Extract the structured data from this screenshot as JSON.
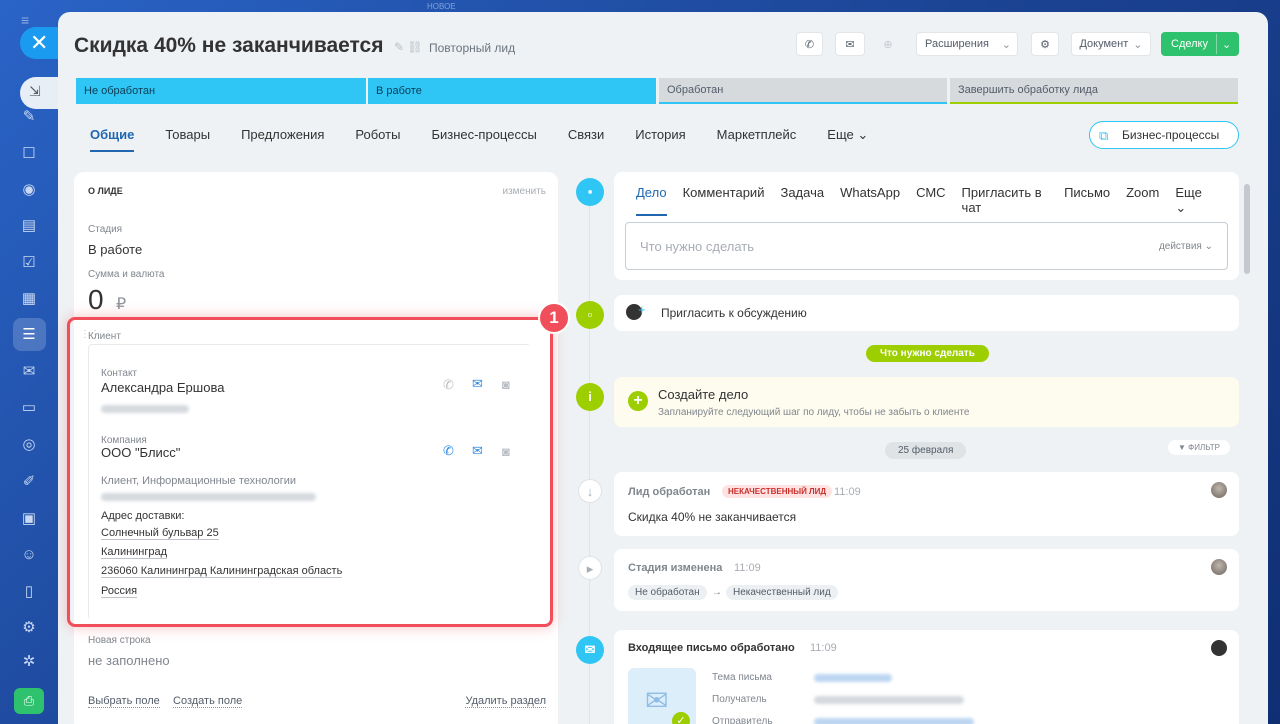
{
  "rail": {
    "top_label": "НОВОЕ"
  },
  "header": {
    "title": "Скидка 40% не заканчивается",
    "repeat_label": "Повторный лид",
    "extensions": "Расширения",
    "document": "Документ",
    "deal": "Сделку"
  },
  "stages": [
    "Не обработан",
    "В работе",
    "Обработан",
    "Завершить обработку лида"
  ],
  "tabs": [
    "Общие",
    "Товары",
    "Предложения",
    "Роботы",
    "Бизнес-процессы",
    "Связи",
    "История",
    "Маркетплейс",
    "Еще"
  ],
  "bp_button": "Бизнес-процессы",
  "about": {
    "title": "О ЛИДЕ",
    "edit": "изменить",
    "stage_label": "Стадия",
    "stage_value": "В работе",
    "sum_label": "Сумма и валюта",
    "sum_value": "0",
    "currency": "₽",
    "client_label": "Клиент",
    "contact_label": "Контакт",
    "contact_name": "Александра Ершова",
    "company_label": "Компания",
    "company_name": "ООО \"Блисс\"",
    "company_type": "Клиент, Информационные технологии",
    "address_label": "Адрес доставки:",
    "address_lines": [
      "Солнечный бульвар 25",
      "Калининград",
      "236060 Калининград Калининградская область",
      "Россия"
    ],
    "new_row_label": "Новая строка",
    "new_row_value": "не заполнено",
    "select_field": "Выбрать поле",
    "create_field": "Создать поле",
    "delete_section": "Удалить раздел",
    "callout_number": "1"
  },
  "activity": {
    "tabs": [
      "Дело",
      "Комментарий",
      "Задача",
      "WhatsApp",
      "СМС",
      "Пригласить в чат",
      "Письмо",
      "Zoom",
      "Еще"
    ],
    "placeholder": "Что нужно сделать",
    "actions": "действия",
    "invite": "Пригласить к обсуждению",
    "todo_pill": "Что нужно сделать",
    "create_title": "Создайте дело",
    "create_hint": "Запланируйте следующий шаг по лиду, чтобы не забыть о клиенте",
    "date": "25 февраля",
    "filter": "ФИЛЬТР"
  },
  "events": {
    "processed_title": "Лид обработан",
    "processed_tag": "НЕКАЧЕСТВЕННЫЙ ЛИД",
    "processed_time": "11:09",
    "processed_text": "Скидка 40% не заканчивается",
    "stage_title": "Стадия изменена",
    "stage_time": "11:09",
    "stage_from": "Не обработан",
    "stage_to": "Некачественный лид",
    "mail_title": "Входящее письмо обработано",
    "mail_time": "11:09",
    "mail_subject_label": "Тема письма",
    "mail_recipient_label": "Получатель",
    "mail_sender_label": "Отправитель"
  },
  "colors": {
    "accent": "#2fc6f6",
    "green": "#2fc26e",
    "lime": "#9dcf00",
    "red": "#ef4e5a"
  }
}
